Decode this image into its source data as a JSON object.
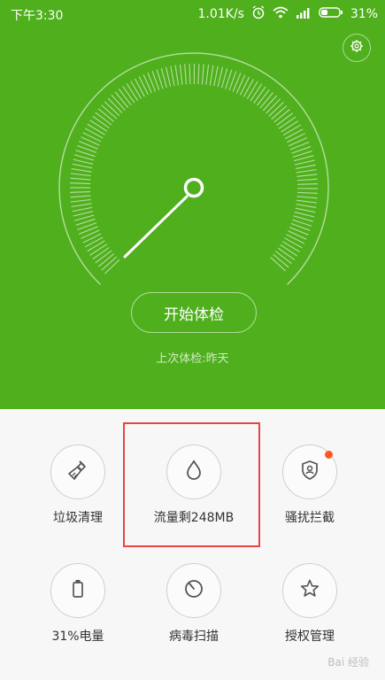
{
  "status_bar": {
    "time": "下午3:30",
    "net_speed": "1.01K/s",
    "battery": "31%"
  },
  "main": {
    "start_button": "开始体检",
    "last_check": "上次体检:昨天"
  },
  "tools": [
    {
      "label": "垃圾清理",
      "icon": "broom-icon"
    },
    {
      "label": "流量剩248MB",
      "icon": "water-drop-icon"
    },
    {
      "label": "骚扰拦截",
      "icon": "shield-person-icon",
      "badge": true
    },
    {
      "label": "31%电量",
      "icon": "battery-icon"
    },
    {
      "label": "病毒扫描",
      "icon": "scan-icon"
    },
    {
      "label": "授权管理",
      "icon": "star-icon"
    }
  ],
  "watermark": "Bai 经验",
  "colors": {
    "accent": "#4faf1c",
    "highlight": "#e84545",
    "badge": "#ff5722"
  }
}
